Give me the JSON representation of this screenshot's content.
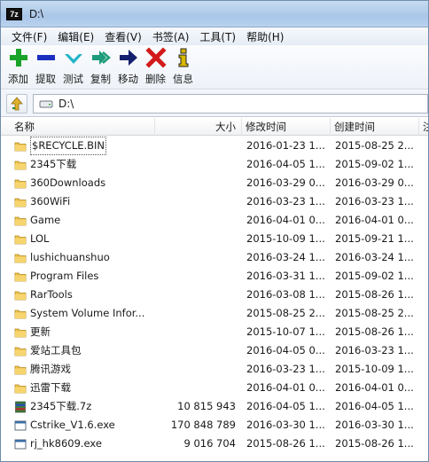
{
  "window": {
    "title": "D:\\",
    "app_icon_text": "7z"
  },
  "menu": [
    {
      "label": "文件(F)"
    },
    {
      "label": "编辑(E)"
    },
    {
      "label": "查看(V)"
    },
    {
      "label": "书签(A)"
    },
    {
      "label": "工具(T)"
    },
    {
      "label": "帮助(H)"
    }
  ],
  "toolbar": [
    {
      "label": "添加",
      "icon": "plus-icon",
      "color": "#1aa32a"
    },
    {
      "label": "提取",
      "icon": "minus-icon",
      "color": "#1a2fc0"
    },
    {
      "label": "测试",
      "icon": "check-icon",
      "color": "#22b5c8"
    },
    {
      "label": "复制",
      "icon": "double-arrow-icon",
      "color": "#1d9b7a"
    },
    {
      "label": "移动",
      "icon": "arrow-right-icon",
      "color": "#14206e"
    },
    {
      "label": "删除",
      "icon": "cross-icon",
      "color": "#d21a1a"
    },
    {
      "label": "信息",
      "icon": "info-icon",
      "color": "#d9b800"
    }
  ],
  "address": {
    "path": "D:\\"
  },
  "columns": {
    "name": "名称",
    "size": "大小",
    "modified": "修改时间",
    "created": "创建时间",
    "extra": "注"
  },
  "rows": [
    {
      "name": "$RECYCLE.BIN",
      "type": "folder",
      "size": "",
      "modified": "2016-01-23 1...",
      "created": "2015-08-25 2..."
    },
    {
      "name": "2345下载",
      "type": "folder",
      "size": "",
      "modified": "2016-04-05 1...",
      "created": "2015-09-02 1..."
    },
    {
      "name": "360Downloads",
      "type": "folder",
      "size": "",
      "modified": "2016-03-29 0...",
      "created": "2016-03-29 0..."
    },
    {
      "name": "360WiFi",
      "type": "folder",
      "size": "",
      "modified": "2016-03-23 1...",
      "created": "2016-03-23 1..."
    },
    {
      "name": "Game",
      "type": "folder",
      "size": "",
      "modified": "2016-04-01 0...",
      "created": "2016-04-01 0..."
    },
    {
      "name": "LOL",
      "type": "folder",
      "size": "",
      "modified": "2015-10-09 1...",
      "created": "2015-09-21 1..."
    },
    {
      "name": "lushichuanshuo",
      "type": "folder",
      "size": "",
      "modified": "2016-03-24 1...",
      "created": "2016-03-24 1..."
    },
    {
      "name": "Program Files",
      "type": "folder",
      "size": "",
      "modified": "2016-03-31 1...",
      "created": "2015-09-02 1..."
    },
    {
      "name": "RarTools",
      "type": "folder",
      "size": "",
      "modified": "2016-03-08 1...",
      "created": "2015-08-26 1..."
    },
    {
      "name": "System Volume Infor...",
      "type": "folder",
      "size": "",
      "modified": "2015-08-25 2...",
      "created": "2015-08-25 2..."
    },
    {
      "name": "更新",
      "type": "folder",
      "size": "",
      "modified": "2015-10-07 1...",
      "created": "2015-08-26 1..."
    },
    {
      "name": "爱站工具包",
      "type": "folder",
      "size": "",
      "modified": "2016-04-05 0...",
      "created": "2016-03-23 1..."
    },
    {
      "name": "腾讯游戏",
      "type": "folder",
      "size": "",
      "modified": "2016-03-23 1...",
      "created": "2015-10-09 1..."
    },
    {
      "name": "迅雷下载",
      "type": "folder",
      "size": "",
      "modified": "2016-04-01 0...",
      "created": "2016-04-01 0..."
    },
    {
      "name": "2345下载.7z",
      "type": "archive",
      "size": "10 815 943",
      "modified": "2016-04-05 1...",
      "created": "2016-04-05 1..."
    },
    {
      "name": "Cstrike_V1.6.exe",
      "type": "exe",
      "size": "170 848 789",
      "modified": "2016-03-30 1...",
      "created": "2016-03-30 1..."
    },
    {
      "name": "rj_hk8609.exe",
      "type": "exe",
      "size": "9 016 704",
      "modified": "2015-08-26 1...",
      "created": "2015-08-26 1..."
    }
  ]
}
